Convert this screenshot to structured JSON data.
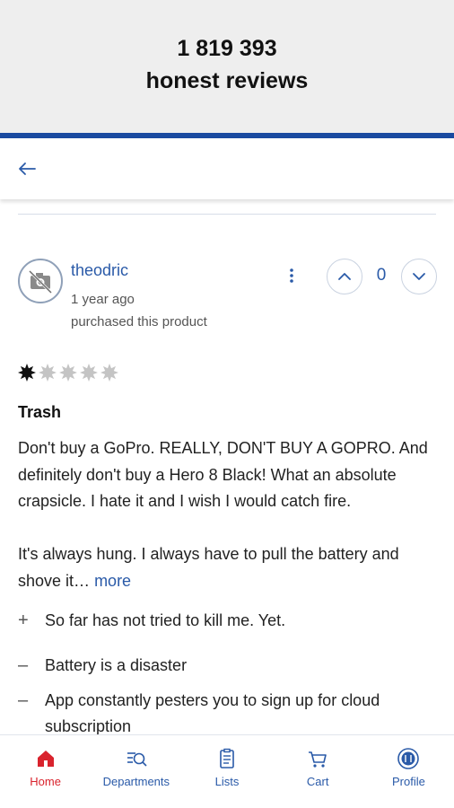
{
  "banner": {
    "count": "1 819 393",
    "subtitle": "honest reviews"
  },
  "topbar": {
    "back_icon": "arrow-left-icon"
  },
  "review": {
    "username": "theodric",
    "time_ago": "1 year ago",
    "purchase_note": "purchased this product",
    "votes": "0",
    "rating": 1,
    "rating_max": 5,
    "title": "Trash",
    "paragraph1": "Don't buy a GoPro. REALLY, DON'T BUY A GOPRO. And definitely don't buy a Hero 8 Black! What an absolute crapsicle. I hate it and I wish I would catch fire.",
    "paragraph2": "It's always hung. I always have to pull the battery and shove it…",
    "more_label": "more",
    "pros": [
      {
        "sign": "+",
        "text": "So far has not tried to kill me. Yet."
      }
    ],
    "cons": [
      {
        "sign": "–",
        "text": "Battery is a disaster"
      },
      {
        "sign": "–",
        "text": "App constantly pesters you to sign up for cloud subscription"
      }
    ]
  },
  "nav": {
    "items": [
      {
        "label": "Home",
        "icon": "home-icon",
        "active": true
      },
      {
        "label": "Departments",
        "icon": "departments-icon",
        "active": false
      },
      {
        "label": "Lists",
        "icon": "list-icon",
        "active": false
      },
      {
        "label": "Cart",
        "icon": "cart-icon",
        "active": false
      },
      {
        "label": "Profile",
        "icon": "profile-icon",
        "active": false
      }
    ]
  },
  "colors": {
    "accent": "#2a5aa8",
    "active": "#d9232d",
    "banner_rule": "#1a4aa0",
    "star_filled": "#111111",
    "star_empty": "#c4c4c4"
  }
}
